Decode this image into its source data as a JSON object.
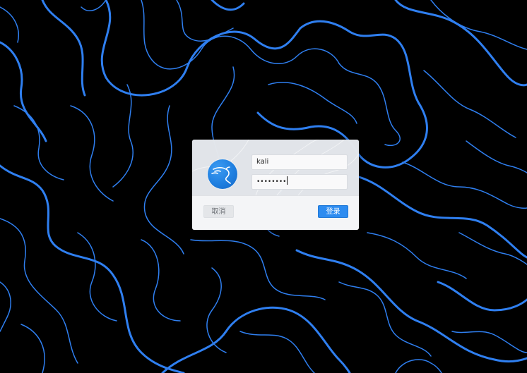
{
  "colors": {
    "background": "#000000",
    "contour_line": "#2f7ff0",
    "accent": "#2d8cf0"
  },
  "login": {
    "avatar_icon": "kali-dragon-icon",
    "username_value": "kali",
    "password_masked": "••••••••",
    "cancel_label": "取消",
    "login_label": "登录"
  }
}
